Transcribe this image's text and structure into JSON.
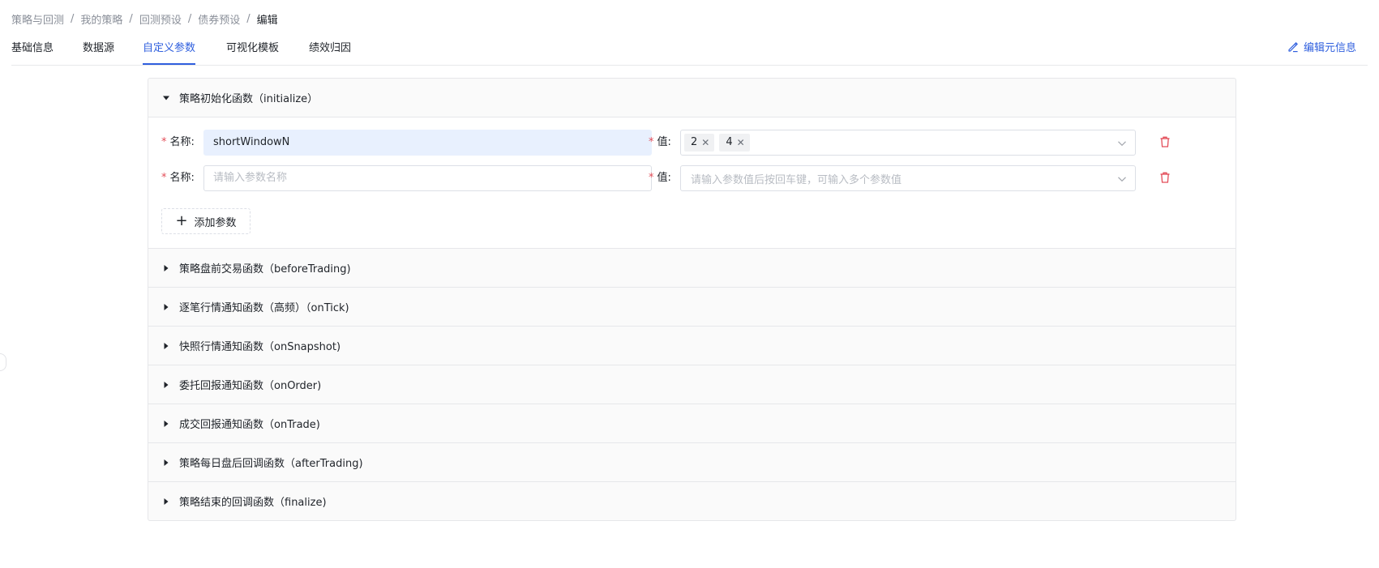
{
  "breadcrumb": {
    "items": [
      "策略与回测",
      "我的策略",
      "回测预设",
      "债券预设"
    ],
    "current": "编辑",
    "separator": "/"
  },
  "tabs": {
    "items": [
      "基础信息",
      "数据源",
      "自定义参数",
      "可视化模板",
      "绩效归因"
    ],
    "active": "自定义参数",
    "edit_meta_label": "编辑元信息"
  },
  "panels": {
    "initialize": {
      "title": "策略初始化函数（initialize）",
      "name_label": "名称:",
      "value_label": "值:",
      "params": [
        {
          "name": "shortWindowN",
          "values": [
            "2",
            "4"
          ]
        },
        {
          "name": "",
          "values": []
        }
      ],
      "name_placeholder": "请输入参数名称",
      "value_placeholder": "请输入参数值后按回车键，可输入多个参数值",
      "add_label": "添加参数"
    },
    "collapsed": [
      "策略盘前交易函数（beforeTrading)",
      "逐笔行情通知函数（高频）（onTick)",
      "快照行情通知函数（onSnapshot)",
      "委托回报通知函数（onOrder)",
      "成交回报通知函数（onTrade)",
      "策略每日盘后回调函数（afterTrading)",
      "策略结束的回调函数（finalize)"
    ]
  },
  "colors": {
    "accent": "#2f5fde",
    "danger": "#e34d59",
    "filled_input": "#e8f0fe"
  },
  "icons": {
    "edit": "edit-icon",
    "expand": "caret-down-icon",
    "collapsed": "caret-right-icon",
    "dropdown": "chevron-down-icon",
    "delete": "trash-icon",
    "add": "plus-icon",
    "tag_remove": "close-icon"
  }
}
